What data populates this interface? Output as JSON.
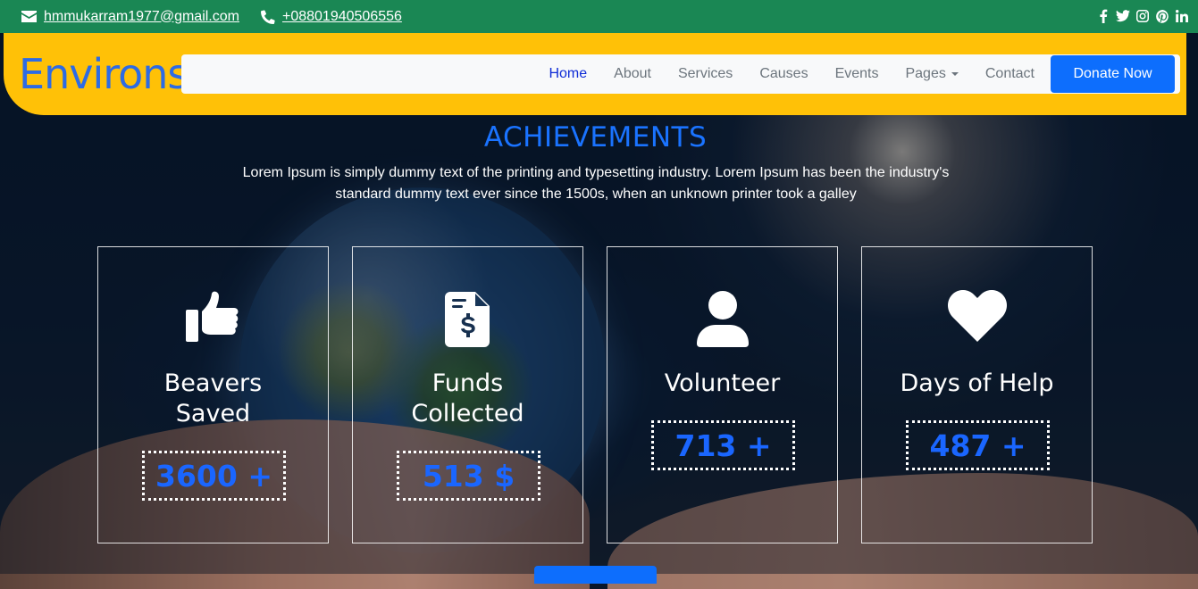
{
  "topbar": {
    "email": "hmmukarram1977@gmail.com",
    "phone": "+08801940506556",
    "social": [
      "facebook-icon",
      "twitter-icon",
      "instagram-icon",
      "pinterest-icon",
      "linkedin-icon"
    ]
  },
  "brand": "Environs",
  "nav": {
    "items": [
      "Home",
      "About",
      "Services",
      "Causes",
      "Events",
      "Pages",
      "Contact"
    ],
    "active": "Home",
    "donate": "Donate Now"
  },
  "achievements": {
    "title": "ACHIEVEMENTS",
    "description": "Lorem Ipsum is simply dummy text of the printing and typesetting industry. Lorem Ipsum has been the industry's standard dummy text ever since the 1500s, when an unknown printer took a galley",
    "cards": [
      {
        "icon": "thumbs-up-icon",
        "label_line1": "Beavers",
        "label_line2": "Saved",
        "value": "3600 +"
      },
      {
        "icon": "invoice-dollar-icon",
        "label_line1": "Funds",
        "label_line2": "Collected",
        "value": "513 $"
      },
      {
        "icon": "user-icon",
        "label_line1": "Volunteer",
        "label_line2": "",
        "value": "713 +"
      },
      {
        "icon": "heart-icon",
        "label_line1": "Days of Help",
        "label_line2": "",
        "value": "487 +"
      }
    ]
  },
  "colors": {
    "topbar": "#1a8754",
    "header": "#ffc107",
    "accent": "#0d6efd",
    "brand": "#2d6be4"
  }
}
